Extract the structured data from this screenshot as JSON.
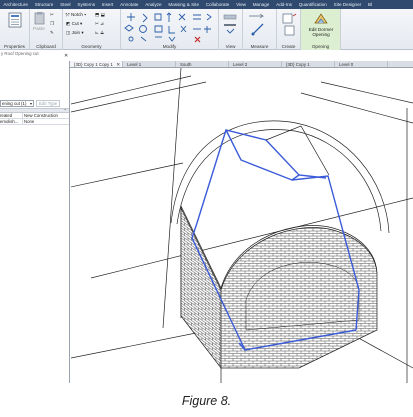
{
  "ribbon": {
    "tabs": [
      "Architecture",
      "Structure",
      "Steel",
      "Systems",
      "Insert",
      "Annotate",
      "Analyze",
      "Massing & Site",
      "Collaborate",
      "View",
      "Manage",
      "Add-Ins",
      "Quantification",
      "Site Designer",
      "Bl"
    ],
    "groups": {
      "properties": "Properties",
      "clipboard": "Clipboard",
      "geometry": "Geometry",
      "modify": "Modify",
      "view": "View",
      "measure": "Measure",
      "create": "Create",
      "opening": "Opening"
    },
    "paste_label": "Paste",
    "geometry_items": {
      "notch": "Notch",
      "cut": "Cut",
      "join": "Join"
    },
    "edit_dormer": "Edit Dormer Opening"
  },
  "status": {
    "context_label": "y Roof Opening cut"
  },
  "properties_panel": {
    "type_selector": "ening cut (1)",
    "edit_type": "Edit Type",
    "rows": [
      {
        "key": "reated",
        "value": "New Construction"
      },
      {
        "key": "emolish...",
        "value": "None"
      }
    ]
  },
  "view_tabs": [
    {
      "label": "{3D} Copy 1 Copy 1",
      "active": true
    },
    {
      "label": "Level 1",
      "active": false
    },
    {
      "label": "South",
      "active": false
    },
    {
      "label": "Level 2",
      "active": false
    },
    {
      "label": "{3D} Copy 1",
      "active": false
    },
    {
      "label": "Level 0",
      "active": false
    }
  ],
  "caption": "Figure 8.",
  "colors": {
    "ribbon_bar": "#2f4a6e",
    "selection": "#3b5bd8",
    "opening_group": "#dcefd0"
  }
}
